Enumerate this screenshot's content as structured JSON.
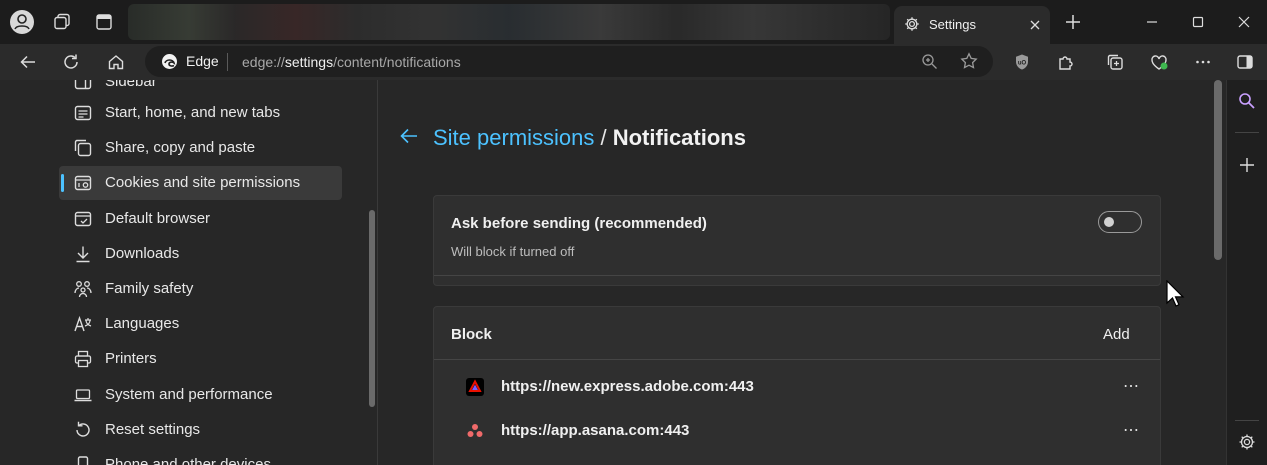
{
  "tab": {
    "title": "Settings"
  },
  "address_bar": {
    "brand": "Edge",
    "url_prefix": "edge://",
    "url_emphasis": "settings",
    "url_suffix": "/content/notifications"
  },
  "sidebar": {
    "items": [
      {
        "label": "Sidebar",
        "icon": "sidebar-icon"
      },
      {
        "label": "Start, home, and new tabs",
        "icon": "start-home-icon"
      },
      {
        "label": "Share, copy and paste",
        "icon": "share-icon"
      },
      {
        "label": "Cookies and site permissions",
        "icon": "cookies-permissions-icon",
        "active": true
      },
      {
        "label": "Default browser",
        "icon": "default-browser-icon"
      },
      {
        "label": "Downloads",
        "icon": "download-icon"
      },
      {
        "label": "Family safety",
        "icon": "family-icon"
      },
      {
        "label": "Languages",
        "icon": "languages-icon"
      },
      {
        "label": "Printers",
        "icon": "printer-icon"
      },
      {
        "label": "System and performance",
        "icon": "laptop-icon"
      },
      {
        "label": "Reset settings",
        "icon": "reset-icon"
      },
      {
        "label": "Phone and other devices",
        "icon": "phone-icon"
      }
    ]
  },
  "main": {
    "breadcrumb_parent": "Site permissions",
    "breadcrumb_separator": " / ",
    "page_title": "Notifications",
    "ask_setting": {
      "title": "Ask before sending (recommended)",
      "subtitle": "Will block if turned off",
      "enabled": false
    },
    "block_section": {
      "title": "Block",
      "add_label": "Add",
      "sites": [
        {
          "url": "https://new.express.adobe.com:443",
          "icon": "adobe-express-icon",
          "more": "⋯"
        },
        {
          "url": "https://app.asana.com:443",
          "icon": "asana-icon",
          "more": "⋯"
        }
      ]
    }
  },
  "colors": {
    "accent": "#4cc2ff",
    "background": "#272727",
    "card": "#2f2f2f",
    "adobe_red": "#eb1000",
    "asana_coral": "#f06a6a"
  }
}
